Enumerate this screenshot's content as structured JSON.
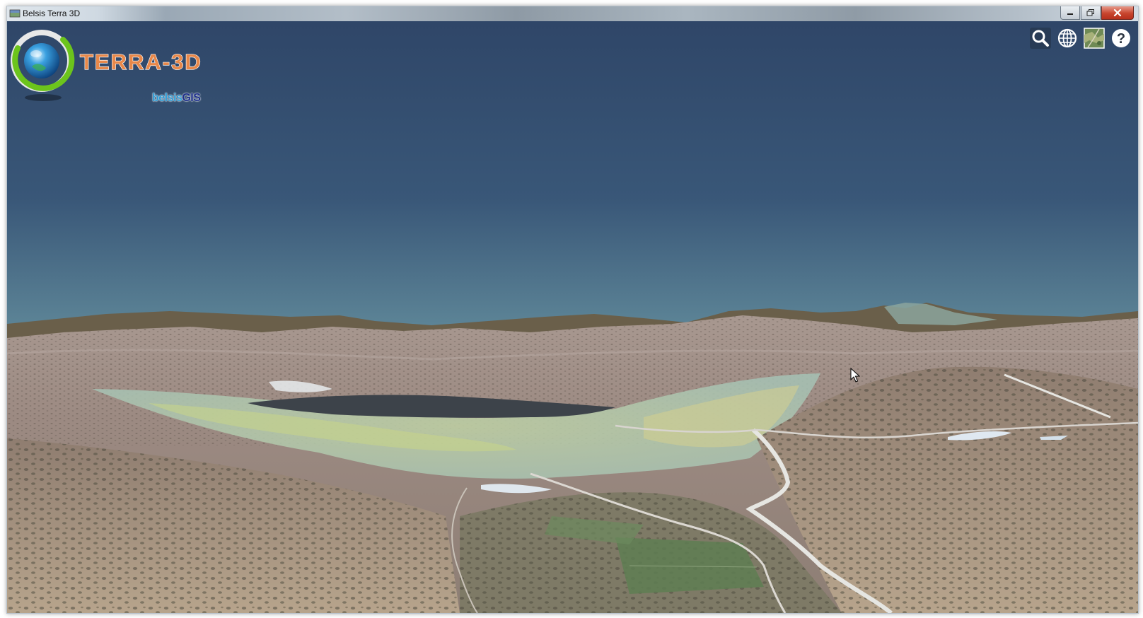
{
  "window": {
    "title": "Belsis Terra 3D",
    "controls": [
      "minimize",
      "restore",
      "close"
    ]
  },
  "logo": {
    "wordmark": "TERRA-3D",
    "sub_brand_part1": "belsis",
    "sub_brand_part2": "GIS",
    "colors": {
      "wordmark": "#e8884a",
      "belsis": "#2f9bd4",
      "gis": "#1d2f8a",
      "ring_green": "#6cc41c"
    }
  },
  "toolbar": {
    "buttons": [
      {
        "name": "search-icon",
        "label": "Search"
      },
      {
        "name": "globe-icon",
        "label": "Globe"
      },
      {
        "name": "satellite-layer-icon",
        "label": "Imagery"
      },
      {
        "name": "help-icon",
        "label": "?"
      }
    ]
  },
  "scene": {
    "sky_top": "#2f4668",
    "sky_horizon": "#5d8597",
    "terrain": "#b39a8f"
  }
}
